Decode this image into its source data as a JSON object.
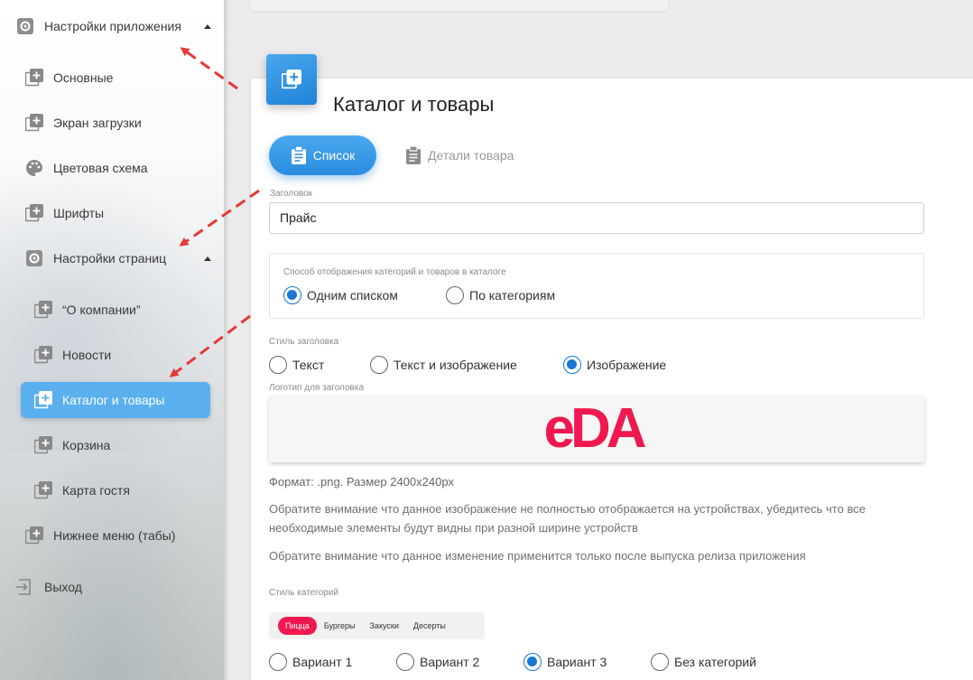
{
  "sidebar": {
    "items": [
      {
        "label": "Настройки приложения",
        "icon": "gear-icon"
      },
      {
        "label": "Основные",
        "icon": "add-square-icon"
      },
      {
        "label": "Экран загрузки",
        "icon": "add-square-icon"
      },
      {
        "label": "Цветовая схема",
        "icon": "palette-icon"
      },
      {
        "label": "Шрифты",
        "icon": "add-square-icon"
      },
      {
        "label": "Настройки страниц",
        "icon": "gear-icon"
      },
      {
        "label": "“О компании”",
        "icon": "add-square-icon"
      },
      {
        "label": "Новости",
        "icon": "add-square-icon"
      },
      {
        "label": "Каталог и товары",
        "icon": "add-square-icon"
      },
      {
        "label": "Корзина",
        "icon": "add-square-icon"
      },
      {
        "label": "Карта гостя",
        "icon": "add-square-icon"
      },
      {
        "label": "Нижнее меню (табы)",
        "icon": "add-square-icon"
      },
      {
        "label": "Выход",
        "icon": "logout-icon"
      }
    ],
    "accent": "#5ab0ee"
  },
  "page": {
    "title": "Каталог и товары",
    "tabs": [
      {
        "label": "Список",
        "icon": "clipboard-icon"
      },
      {
        "label": "Детали товара",
        "icon": "clipboard-icon"
      }
    ]
  },
  "form": {
    "header_label": "Заголовок",
    "header_value": "Прайс",
    "display_mode": {
      "label": "Способ отображения категорий и товаров в каталоге",
      "options": [
        "Одним списком",
        "По категориям"
      ]
    },
    "header_style": {
      "label": "Стиль заголовка",
      "options": [
        "Текст",
        "Текст и изображение",
        "Изображение"
      ]
    },
    "logo": {
      "label": "Логотип для заголовка",
      "text": "eDA",
      "color": "#f0184f"
    },
    "format_note": "Формат: .png. Размер 2400x240px",
    "notice1": "Обратите внимание что данное изображение не полностью отображается на устройствах, убедитесь что все необходимые элементы будут видны при разной ширине устройств",
    "notice2": "Обратите внимание что данное изменение применится только после выпуска релиза приложения",
    "category_style": {
      "label": "Стиль категорий",
      "chips": [
        "Пицца",
        "Бургеры",
        "Закуски",
        "Десерты"
      ],
      "options": [
        "Вариант 1",
        "Вариант 2",
        "Вариант 3",
        "Без категорий"
      ]
    }
  },
  "colors": {
    "primary": "#2a8be0",
    "radio_selected": "#1976d2",
    "arrow": "#e53935",
    "chip_active": "#f0184f"
  }
}
